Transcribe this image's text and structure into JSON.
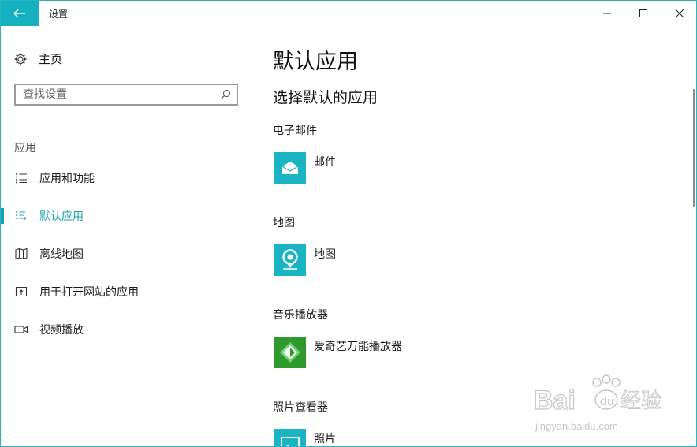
{
  "window": {
    "title": "设置"
  },
  "sidebar": {
    "home_label": "主页",
    "search_placeholder": "查找设置",
    "section_label": "应用",
    "items": [
      {
        "label": "应用和功能",
        "icon": "list-icon"
      },
      {
        "label": "默认应用",
        "icon": "default-apps-icon",
        "active": true
      },
      {
        "label": "离线地图",
        "icon": "map-icon"
      },
      {
        "label": "用于打开网站的应用",
        "icon": "open-link-icon"
      },
      {
        "label": "视频播放",
        "icon": "video-icon"
      }
    ]
  },
  "main": {
    "title": "默认应用",
    "subtitle": "选择默认的应用",
    "categories": [
      {
        "label": "电子邮件",
        "app": "邮件",
        "icon": "mail-icon",
        "tile_color": "#1ab4c4"
      },
      {
        "label": "地图",
        "app": "地图",
        "icon": "maps-pin-icon",
        "tile_color": "#1ab4c4"
      },
      {
        "label": "音乐播放器",
        "app": "爱奇艺万能播放器",
        "icon": "iqiyi-icon",
        "tile_color": "#2e9a2e"
      },
      {
        "label": "照片查看器",
        "app": "照片",
        "icon": "photos-icon",
        "tile_color": "#1ab4c4"
      }
    ]
  },
  "colors": {
    "accent": "#16a0b0",
    "tile": "#1ab4c4",
    "back_button": "#15b1c1"
  },
  "watermark": {
    "brand_left": "Bai",
    "brand_right": "经验",
    "url": "jingyan.baidu.com"
  }
}
